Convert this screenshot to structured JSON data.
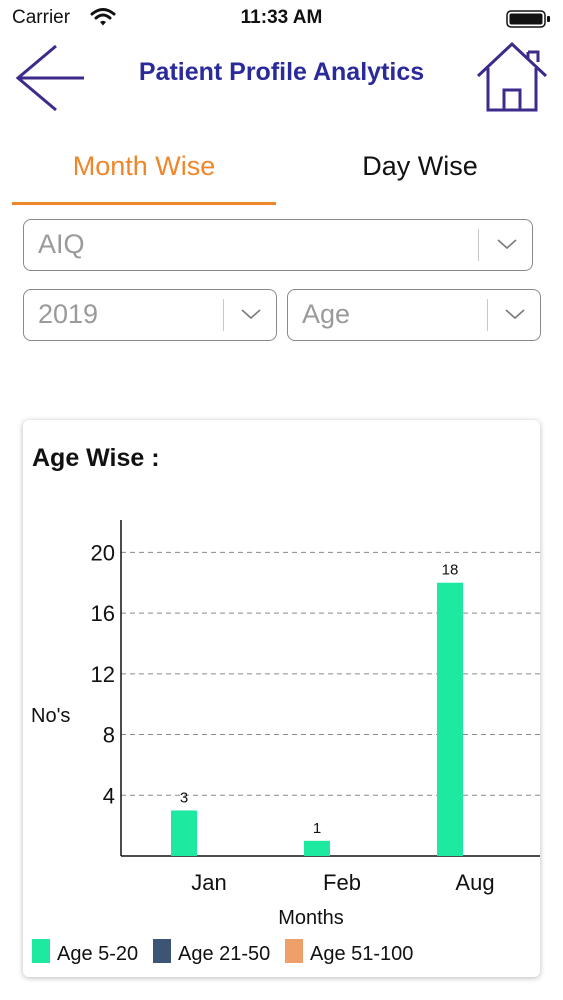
{
  "status": {
    "carrier": "Carrier",
    "time": "11:33 AM"
  },
  "header": {
    "title": "Patient Profile Analytics"
  },
  "tabs": [
    {
      "label": "Month Wise"
    },
    {
      "label": "Day Wise"
    }
  ],
  "filters": {
    "category": {
      "value": "AIQ"
    },
    "year": {
      "value": "2019"
    },
    "group": {
      "value": "Age"
    }
  },
  "chart_section": {
    "heading": "Age Wise :"
  },
  "colors": {
    "accent": "#f0862a",
    "title": "#2a2a9a",
    "icon": "#3d2a8a"
  },
  "chart_data": {
    "type": "bar",
    "title": "Age Wise :",
    "xlabel": "Months",
    "ylabel": "No's",
    "categories": [
      "Jan",
      "Feb",
      "Aug"
    ],
    "ylim": [
      0,
      22
    ],
    "yticks": [
      4,
      8,
      12,
      16,
      20
    ],
    "grid": true,
    "legend_position": "bottom-left",
    "series": [
      {
        "name": "Age 5-20",
        "color": "#1de9a0",
        "values": [
          3,
          1,
          18
        ]
      },
      {
        "name": "Age 21-50",
        "color": "#3d5575",
        "values": [
          0,
          0,
          0
        ]
      },
      {
        "name": "Age 51-100",
        "color": "#efa06a",
        "values": [
          0,
          0,
          0
        ]
      }
    ]
  }
}
